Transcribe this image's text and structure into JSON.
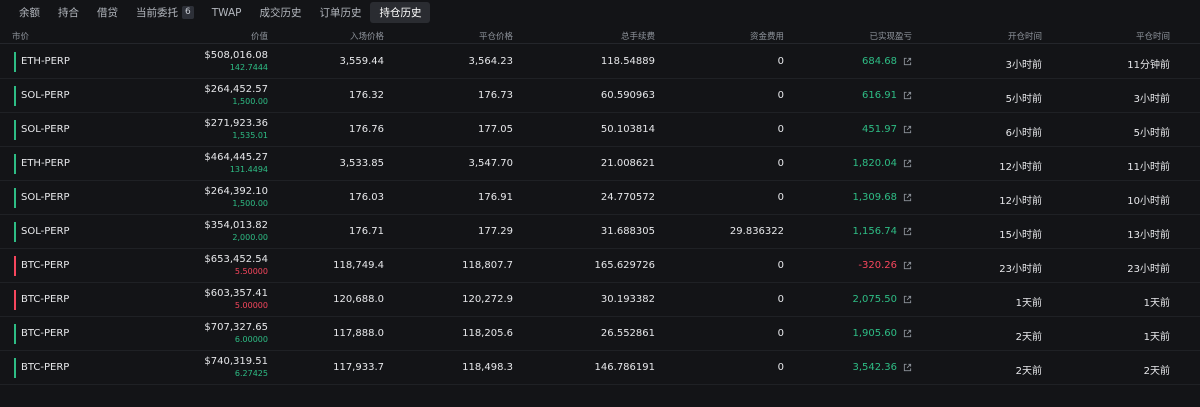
{
  "tabs": [
    {
      "label": "余额"
    },
    {
      "label": "持合"
    },
    {
      "label": "借贷"
    },
    {
      "label": "当前委托",
      "badge": "6"
    },
    {
      "label": "TWAP"
    },
    {
      "label": "成交历史"
    },
    {
      "label": "订单历史"
    },
    {
      "label": "持仓历史",
      "active": true
    }
  ],
  "columns": {
    "market": "市价",
    "value": "价值",
    "entry": "入场价格",
    "exit": "平仓价格",
    "fee": "总手续费",
    "funding": "资金费用",
    "pnl": "已实现盈亏",
    "open_time": "开仓时间",
    "close_time": "平仓时间"
  },
  "colors": {
    "long": "#2ebd85",
    "short": "#f6465d"
  },
  "rows": [
    {
      "market": "ETH-PERP",
      "side": "long",
      "value": "$508,016.08",
      "size": "142.7444",
      "entry": "3,559.44",
      "exit": "3,564.23",
      "fee": "118.54889",
      "funding": "0",
      "pnl": "684.68",
      "pnl_sign": "positive",
      "open_time": "3小时前",
      "close_time": "11分钟前"
    },
    {
      "market": "SOL-PERP",
      "side": "long",
      "value": "$264,452.57",
      "size": "1,500.00",
      "entry": "176.32",
      "exit": "176.73",
      "fee": "60.590963",
      "funding": "0",
      "pnl": "616.91",
      "pnl_sign": "positive",
      "open_time": "5小时前",
      "close_time": "3小时前"
    },
    {
      "market": "SOL-PERP",
      "side": "long",
      "value": "$271,923.36",
      "size": "1,535.01",
      "entry": "176.76",
      "exit": "177.05",
      "fee": "50.103814",
      "funding": "0",
      "pnl": "451.97",
      "pnl_sign": "positive",
      "open_time": "6小时前",
      "close_time": "5小时前"
    },
    {
      "market": "ETH-PERP",
      "side": "long",
      "value": "$464,445.27",
      "size": "131.4494",
      "entry": "3,533.85",
      "exit": "3,547.70",
      "fee": "21.008621",
      "funding": "0",
      "pnl": "1,820.04",
      "pnl_sign": "positive",
      "open_time": "12小时前",
      "close_time": "11小时前"
    },
    {
      "market": "SOL-PERP",
      "side": "long",
      "value": "$264,392.10",
      "size": "1,500.00",
      "entry": "176.03",
      "exit": "176.91",
      "fee": "24.770572",
      "funding": "0",
      "pnl": "1,309.68",
      "pnl_sign": "positive",
      "open_time": "12小时前",
      "close_time": "10小时前"
    },
    {
      "market": "SOL-PERP",
      "side": "long",
      "value": "$354,013.82",
      "size": "2,000.00",
      "entry": "176.71",
      "exit": "177.29",
      "fee": "31.688305",
      "funding": "29.836322",
      "pnl": "1,156.74",
      "pnl_sign": "positive",
      "open_time": "15小时前",
      "close_time": "13小时前"
    },
    {
      "market": "BTC-PERP",
      "side": "short",
      "value": "$653,452.54",
      "size": "5.50000",
      "entry": "118,749.4",
      "exit": "118,807.7",
      "fee": "165.629726",
      "funding": "0",
      "pnl": "-320.26",
      "pnl_sign": "negative",
      "open_time": "23小时前",
      "close_time": "23小时前"
    },
    {
      "market": "BTC-PERP",
      "side": "short",
      "value": "$603,357.41",
      "size": "5.00000",
      "entry": "120,688.0",
      "exit": "120,272.9",
      "fee": "30.193382",
      "funding": "0",
      "pnl": "2,075.50",
      "pnl_sign": "positive",
      "open_time": "1天前",
      "close_time": "1天前"
    },
    {
      "market": "BTC-PERP",
      "side": "long",
      "value": "$707,327.65",
      "size": "6.00000",
      "entry": "117,888.0",
      "exit": "118,205.6",
      "fee": "26.552861",
      "funding": "0",
      "pnl": "1,905.60",
      "pnl_sign": "positive",
      "open_time": "2天前",
      "close_time": "1天前"
    },
    {
      "market": "BTC-PERP",
      "side": "long",
      "value": "$740,319.51",
      "size": "6.27425",
      "entry": "117,933.7",
      "exit": "118,498.3",
      "fee": "146.786191",
      "funding": "0",
      "pnl": "3,542.36",
      "pnl_sign": "positive",
      "open_time": "2天前",
      "close_time": "2天前"
    }
  ]
}
